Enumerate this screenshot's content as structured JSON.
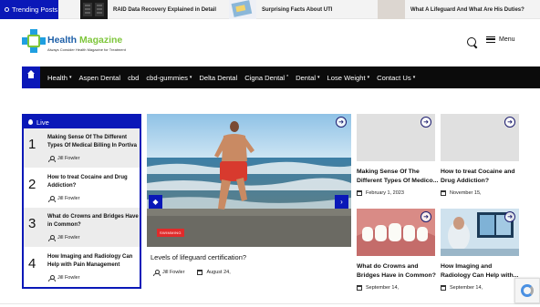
{
  "trending": {
    "label": "Trending Posts",
    "items": [
      {
        "title": "RAID Data Recovery Explained in Detail"
      },
      {
        "title": "Surprising Facts About UTI"
      },
      {
        "title": "What A Lifeguard And What Are His Duties?"
      }
    ]
  },
  "header": {
    "logo_main": "Health ",
    "logo_accent": "Magazine",
    "logo_tagline": "Always Consider Health Magazine for Treatment",
    "menu_label": "Menu"
  },
  "nav": {
    "items": [
      {
        "label": "Health",
        "dropdown": true
      },
      {
        "label": "Aspen Dental",
        "dropdown": false
      },
      {
        "label": "cbd",
        "dropdown": false
      },
      {
        "label": "cbd-gummies",
        "dropdown": true
      },
      {
        "label": "Delta Dental",
        "dropdown": false
      },
      {
        "label": "Cigna Dental",
        "dropdown": false,
        "sup": "*"
      },
      {
        "label": "Dental",
        "dropdown": true
      },
      {
        "label": "Lose Weight",
        "dropdown": true
      },
      {
        "label": "Contact Us",
        "dropdown": true
      }
    ]
  },
  "live": {
    "heading": "Live",
    "items": [
      {
        "num": "1",
        "title": "Making Sense Of The Different Types Of Medical Billing In Portiva",
        "author": "Jill Fowler"
      },
      {
        "num": "2",
        "title": "How to treat Cocaine and Drug Addiction?",
        "author": "Jill Fowler"
      },
      {
        "num": "3",
        "title": "What do Crowns and Bridges Have in Common?",
        "author": "Jill Fowler"
      },
      {
        "num": "4",
        "title": "How Imaging and Radiology Can Help with Pain Management",
        "author": "Jill Fowler"
      }
    ]
  },
  "featured": {
    "category": "SWIMMING",
    "title": "Levels of lifeguard certification?",
    "author": "Jill Fowler",
    "date": "August 24,"
  },
  "cards": [
    {
      "title": "Making Sense Of The Different Types Of Medico...",
      "date": "February 1, 2023"
    },
    {
      "title": "How to treat Cocaine and Drug Addiction?",
      "date": "November 15,"
    },
    {
      "title": "What do Crowns and Bridges Have in Common?",
      "date": "September 14,"
    },
    {
      "title": "How Imaging and Radiology Can Help with...",
      "date": "September 14,"
    }
  ],
  "colors": {
    "accent": "#0a18b8",
    "nav_bg": "#0b0b0b",
    "badge": "#e02b2b"
  }
}
